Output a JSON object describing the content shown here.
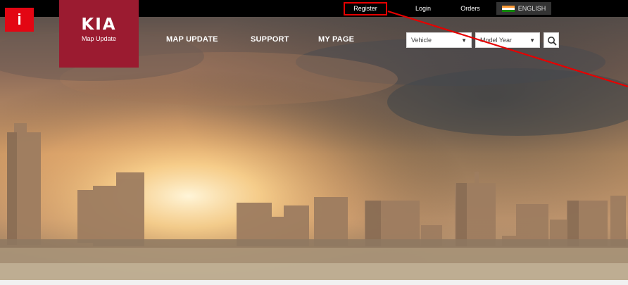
{
  "header": {
    "utility": {
      "register": "Register",
      "login": "Login",
      "orders": "Orders",
      "language": "ENGLISH"
    },
    "logo": {
      "brand": "KIA",
      "subtitle": "Map Update"
    },
    "nav": {
      "map_update": "MAP UPDATE",
      "support": "SUPPORT",
      "my_page": "MY PAGE"
    },
    "selectors": {
      "vehicle": "Vehicle",
      "model_year": "Model Year"
    }
  },
  "annotation": {
    "badge": "i"
  },
  "colors": {
    "brand": "#9b1b30",
    "annotation": "#e30613",
    "topbar": "#000000"
  },
  "icons": {
    "search": "search-icon",
    "flag": "india-flag-icon",
    "dropdown": "chevron-down-icon"
  }
}
